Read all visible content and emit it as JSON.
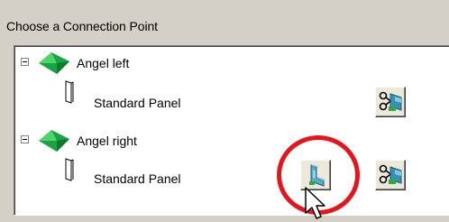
{
  "group": {
    "title": "Choose a Connection Point"
  },
  "tree": {
    "nodes": [
      {
        "label": "Angel left",
        "child_label": "Standard Panel"
      },
      {
        "label": "Angel right",
        "child_label": "Standard Panel"
      }
    ]
  },
  "colors": {
    "gem_green": "#22b14c",
    "highlight_red": "#e8141b",
    "button_face": "#ece9d8",
    "tree_background": "#ffffff",
    "dialog_background": "#d4d0c8"
  },
  "icons": {
    "expander": "collapse-minus-icon",
    "node": "green-gem-icon",
    "child": "panel-outline-icon",
    "connect": "connect-part-icon",
    "disconnect": "scissors-cut-icon"
  }
}
